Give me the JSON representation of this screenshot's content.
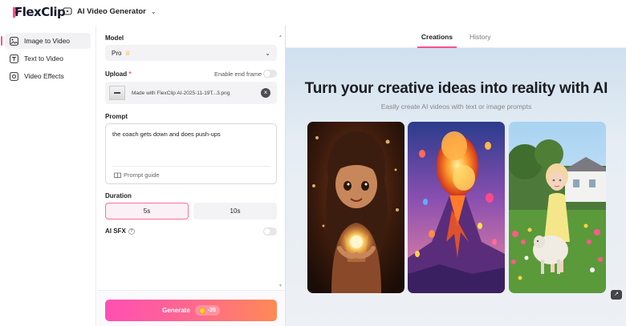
{
  "app": {
    "logo_text": "FlexClip",
    "tool_selector": "AI Video Generator"
  },
  "sidebar": {
    "items": [
      {
        "label": "Image to Video",
        "icon": "image-video-icon",
        "active": true
      },
      {
        "label": "Text to Video",
        "icon": "text-video-icon",
        "active": false
      },
      {
        "label": "Video Effects",
        "icon": "video-effects-icon",
        "active": false
      }
    ]
  },
  "panel": {
    "model_label": "Model",
    "model_value": "Pro",
    "model_badge_icon": "crown-icon",
    "upload_label": "Upload",
    "upload_required_mark": "*",
    "end_frame_label": "Enable end frame",
    "upload_file_name": "Made with FlexClip AI-2025-11-19T...3.png",
    "prompt_label": "Prompt",
    "prompt_text": "the coach gets down and does push-ups",
    "prompt_guide_label": "Prompt guide",
    "duration_label": "Duration",
    "durations": [
      "5s",
      "10s"
    ],
    "duration_selected": "5s",
    "sfx_label": "AI SFX",
    "generate_label": "Generate",
    "generate_cost": "-35"
  },
  "right": {
    "tabs": [
      "Creations",
      "History"
    ],
    "active_tab": "Creations",
    "hero_title": "Turn your creative ideas into reality with AI",
    "hero_subtitle": "Easily create AI videos with text or image prompts",
    "sample_images": [
      "animated-girl-holding-glowing-orb",
      "erupting-volcano-with-hot-air-balloons",
      "little-girl-with-lamb-in-garden"
    ]
  },
  "colors": {
    "accent": "#ff4f8b",
    "generate_gradient_start": "#ff4fb4",
    "generate_gradient_end": "#ff8a55",
    "selected_border": "#ff6f8f"
  }
}
